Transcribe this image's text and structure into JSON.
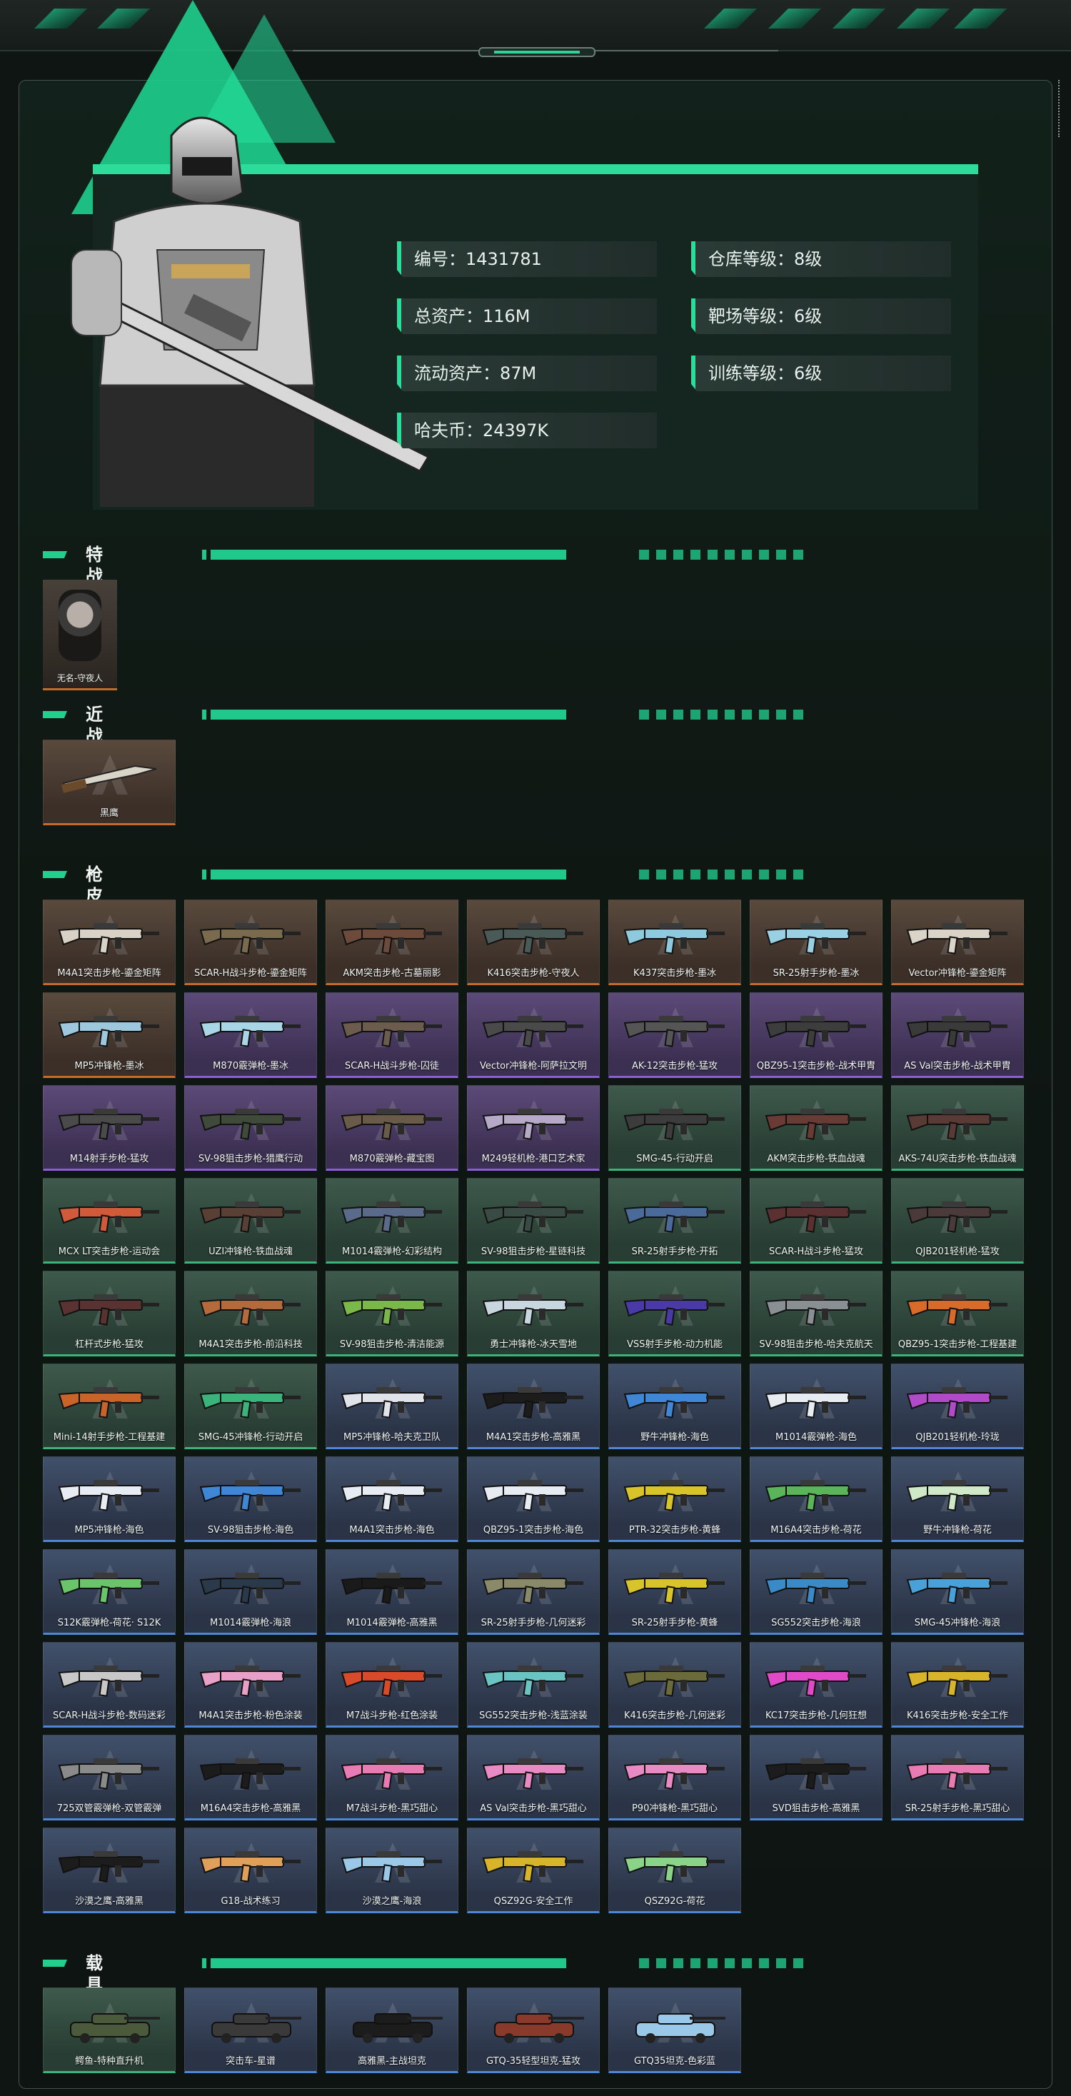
{
  "profile": {
    "id_label": "编号：1431781",
    "assets_label": "总资产：116M",
    "liquid_label": "流动资产：87M",
    "coins_label": "哈夫币：24397K",
    "warehouse_label": "仓库等级：8级",
    "range_label": "靶场等级：6级",
    "training_label": "训练等级：6级"
  },
  "sections": {
    "agents": "特战干员外观",
    "melee": "近战",
    "skins": "枪皮",
    "vehicles": "载具外观"
  },
  "agent": {
    "name": "无名-守夜人",
    "quality": "orange"
  },
  "melee": [
    {
      "name": "黑鹰",
      "quality": "orange"
    }
  ],
  "gun_skins": [
    {
      "name": "M4A1突击步枪-鎏金矩阵",
      "quality": "orange",
      "color": "#d8d2c6"
    },
    {
      "name": "SCAR-H战斗步枪-鎏金矩阵",
      "quality": "orange",
      "color": "#7a6a4e"
    },
    {
      "name": "AKM突击步枪-古墓丽影",
      "quality": "orange",
      "color": "#6e4a3a"
    },
    {
      "name": "K416突击步枪-守夜人",
      "quality": "orange",
      "color": "#4a5a56"
    },
    {
      "name": "K437突击步枪-墨冰",
      "quality": "orange",
      "color": "#8fc9dd"
    },
    {
      "name": "SR-25射手步枪-墨冰",
      "quality": "orange",
      "color": "#9ad0e4"
    },
    {
      "name": "Vector冲锋枪-鎏金矩阵",
      "quality": "orange",
      "color": "#d9d3c8"
    },
    {
      "name": "MP5冲锋枪-墨冰",
      "quality": "orange",
      "color": "#9cc7dc"
    },
    {
      "name": "M870霰弹枪-墨冰",
      "quality": "purple",
      "color": "#a9d6e6"
    },
    {
      "name": "SCAR-H战斗步枪-囚徒",
      "quality": "purple",
      "color": "#6b5c4e"
    },
    {
      "name": "Vector冲锋枪-阿萨拉文明",
      "quality": "purple",
      "color": "#4a4a4a"
    },
    {
      "name": "AK-12突击步枪-猛攻",
      "quality": "purple",
      "color": "#555555"
    },
    {
      "name": "QBZ95-1突击步枪-战术甲胄",
      "quality": "purple",
      "color": "#3d3d3d"
    },
    {
      "name": "AS Val突击步枪-战术甲胄",
      "quality": "purple",
      "color": "#3a3a3a"
    },
    {
      "name": "M14射手步枪-猛攻",
      "quality": "purple",
      "color": "#4a4a4a"
    },
    {
      "name": "SV-98狙击步枪-猎鹰行动",
      "quality": "purple",
      "color": "#3f4a3a"
    },
    {
      "name": "M870霰弹枪-藏宝图",
      "quality": "purple",
      "color": "#6a5a48"
    },
    {
      "name": "M249轻机枪-港口艺术家",
      "quality": "purple",
      "color": "#b6a9c7"
    },
    {
      "name": "SMG-45-行动开启",
      "quality": "green",
      "color": "#3c3c3c"
    },
    {
      "name": "AKM突击步枪-铁血战魂",
      "quality": "green",
      "color": "#6a3a34"
    },
    {
      "name": "AKS-74U突击步枪-铁血战魂",
      "quality": "green",
      "color": "#5a3a34"
    },
    {
      "name": "MCX LT突击步枪-运动会",
      "quality": "green",
      "color": "#d05a3a"
    },
    {
      "name": "UZI冲锋枪-铁血战魂",
      "quality": "green",
      "color": "#5a4034"
    },
    {
      "name": "M1014霰弹枪-幻彩结构",
      "quality": "green",
      "color": "#5a6a8a"
    },
    {
      "name": "SV-98狙击步枪-星链科技",
      "quality": "green",
      "color": "#3a4a44"
    },
    {
      "name": "SR-25射手步枪-开拓",
      "quality": "green",
      "color": "#4a6a9a"
    },
    {
      "name": "SCAR-H战斗步枪-猛攻",
      "quality": "green",
      "color": "#5a3030"
    },
    {
      "name": "QJB201轻机枪-猛攻",
      "quality": "green",
      "color": "#4a3a3a"
    },
    {
      "name": "杠杆式步枪-猛攻",
      "quality": "green",
      "color": "#5a3232"
    },
    {
      "name": "M4A1突击步枪-前沿科技",
      "quality": "green",
      "color": "#b46a3a"
    },
    {
      "name": "SV-98狙击步枪-清洁能源",
      "quality": "green",
      "color": "#7ab84a"
    },
    {
      "name": "勇士冲锋枪-冰天雪地",
      "quality": "green",
      "color": "#c8d6e0"
    },
    {
      "name": "VSS射手步枪-动力机能",
      "quality": "green",
      "color": "#4a3aa8"
    },
    {
      "name": "SV-98狙击步枪-哈夫克航天",
      "quality": "green",
      "color": "#8a8f94"
    },
    {
      "name": "QBZ95-1突击步枪-工程基建",
      "quality": "green",
      "color": "#d86a2a"
    },
    {
      "name": "Mini-14射手步枪-工程基建",
      "quality": "green",
      "color": "#c8642a"
    },
    {
      "name": "SMG-45冲锋枪-行动开启",
      "quality": "green",
      "color": "#3ab47a"
    },
    {
      "name": "MP5冲锋枪-哈夫克卫队",
      "quality": "blue",
      "color": "#e0e4ea"
    },
    {
      "name": "M4A1突击步枪-高雅黑",
      "quality": "blue",
      "color": "#1c1c1c"
    },
    {
      "name": "野牛冲锋枪-海色",
      "quality": "blue",
      "color": "#3f86d6"
    },
    {
      "name": "M1014霰弹枪-海色",
      "quality": "blue",
      "color": "#e6ecf2"
    },
    {
      "name": "QJB201轻机枪-玲珑",
      "quality": "blue",
      "color": "#b04ac8"
    },
    {
      "name": "MP5冲锋枪-海色",
      "quality": "blue",
      "color": "#e6ecf2"
    },
    {
      "name": "SV-98狙击步枪-海色",
      "quality": "blue",
      "color": "#3f86d6"
    },
    {
      "name": "M4A1突击步枪-海色",
      "quality": "blue",
      "color": "#e6ecf2"
    },
    {
      "name": "QBZ95-1突击步枪-海色",
      "quality": "blue",
      "color": "#e6ecf2"
    },
    {
      "name": "PTR-32突击步枪-黄蜂",
      "quality": "blue",
      "color": "#d8c42a"
    },
    {
      "name": "M16A4突击步枪-荷花",
      "quality": "blue",
      "color": "#5ab45a"
    },
    {
      "name": "野牛冲锋枪-荷花",
      "quality": "blue",
      "color": "#cfe8c8"
    },
    {
      "name": "S12K霰弹枪-荷花· S12K",
      "quality": "blue",
      "color": "#6ac46a"
    },
    {
      "name": "M1014霰弹枪-海浪",
      "quality": "blue",
      "color": "#2a3a4a"
    },
    {
      "name": "M1014霰弹枪-高雅黑",
      "quality": "blue",
      "color": "#1a1a1a"
    },
    {
      "name": "SR-25射手步枪-几何迷彩",
      "quality": "blue",
      "color": "#8a8a6a"
    },
    {
      "name": "SR-25射手步枪-黄蜂",
      "quality": "blue",
      "color": "#d8c42a"
    },
    {
      "name": "SG552突击步枪-海浪",
      "quality": "blue",
      "color": "#3a8ac8"
    },
    {
      "name": "SMG-45冲锋枪-海浪",
      "quality": "blue",
      "color": "#4aa0d8"
    },
    {
      "name": "SCAR-H战斗步枪-数码迷彩",
      "quality": "blue",
      "color": "#c8c8c8"
    },
    {
      "name": "M4A1突击步枪-粉色涂装",
      "quality": "blue",
      "color": "#e8a0c8"
    },
    {
      "name": "M7战斗步枪-红色涂装",
      "quality": "blue",
      "color": "#d84a2a"
    },
    {
      "name": "SG552突击步枪-浅蓝涂装",
      "quality": "blue",
      "color": "#6ac4c4"
    },
    {
      "name": "K416突击步枪-几何迷彩",
      "quality": "blue",
      "color": "#6a6a3a"
    },
    {
      "name": "KC17突击步枪-几何狂想",
      "quality": "blue",
      "color": "#e04ac8"
    },
    {
      "name": "K416突击步枪-安全工作",
      "quality": "blue",
      "color": "#d8b42a"
    },
    {
      "name": "725双管霰弹枪-双管霰弹",
      "quality": "blue",
      "color": "#8a8a8a"
    },
    {
      "name": "M16A4突击步枪-高雅黑",
      "quality": "blue",
      "color": "#1c1c1c"
    },
    {
      "name": "M7战斗步枪-黑巧甜心",
      "quality": "blue",
      "color": "#e87ab4"
    },
    {
      "name": "AS Val突击步枪-黑巧甜心",
      "quality": "blue",
      "color": "#e88ac4"
    },
    {
      "name": "P90冲锋枪-黑巧甜心",
      "quality": "blue",
      "color": "#e88ac4"
    },
    {
      "name": "SVD狙击步枪-高雅黑",
      "quality": "blue",
      "color": "#1c1c1c"
    },
    {
      "name": "SR-25射手步枪-黑巧甜心",
      "quality": "blue",
      "color": "#e87ab4"
    },
    {
      "name": "沙漠之鹰-高雅黑",
      "quality": "blue",
      "color": "#1c1c1c"
    },
    {
      "name": "G18-战术练习",
      "quality": "blue",
      "color": "#e0a05a"
    },
    {
      "name": "沙漠之鹰-海浪",
      "quality": "blue",
      "color": "#9ac8e8"
    },
    {
      "name": "QSZ92G-安全工作",
      "quality": "blue",
      "color": "#d8b42a"
    },
    {
      "name": "QSZ92G-荷花",
      "quality": "blue",
      "color": "#8ad48a"
    }
  ],
  "vehicles": [
    {
      "name": "鳄鱼-特种直升机",
      "quality": "green",
      "color": "#4a5a3a"
    },
    {
      "name": "突击车-星谱",
      "quality": "blue",
      "color": "#3a3a3a"
    },
    {
      "name": "高雅黑-主战坦克",
      "quality": "blue",
      "color": "#1c1c1c"
    },
    {
      "name": "GTQ-35轻型坦克-猛攻",
      "quality": "blue",
      "color": "#8a3a2a"
    },
    {
      "name": "GTQ35坦克-色彩蓝",
      "quality": "blue",
      "color": "#9ac8e8"
    }
  ]
}
